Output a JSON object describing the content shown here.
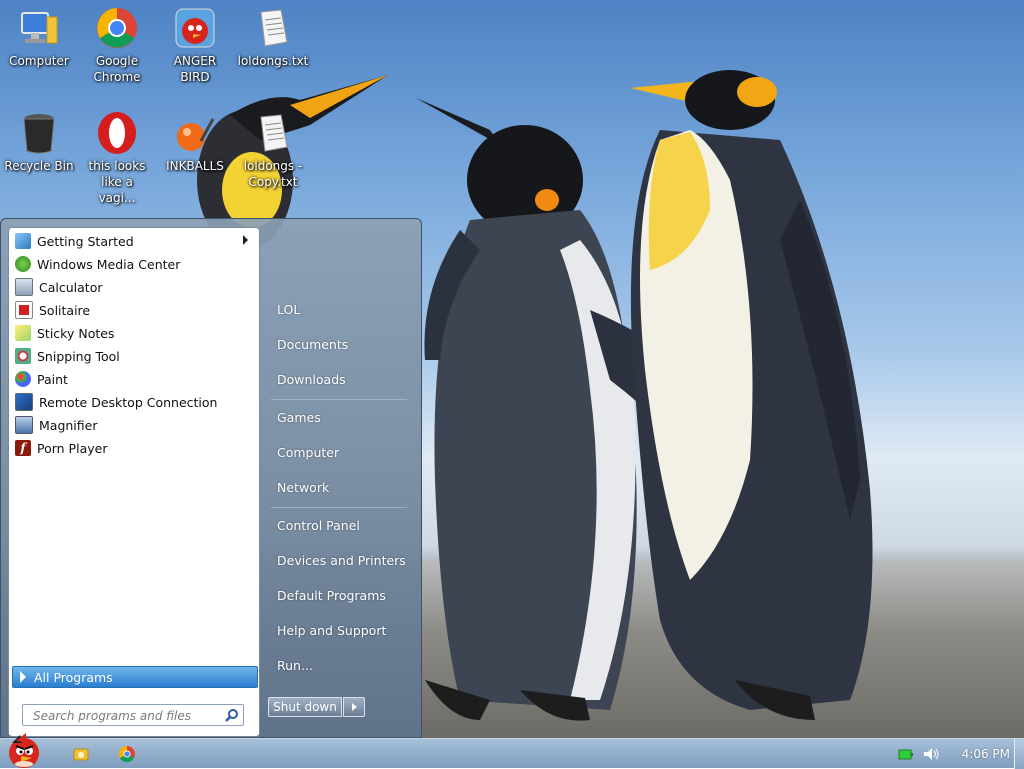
{
  "desktop": {
    "icons": [
      {
        "label": "Computer",
        "icon": "computer-icon"
      },
      {
        "label": "Google Chrome",
        "icon": "chrome-icon"
      },
      {
        "label": "ANGER BIRD",
        "icon": "angry-bird-icon"
      },
      {
        "label": "loldongs.txt",
        "icon": "text-file-icon"
      },
      {
        "label": "Recycle Bin",
        "icon": "recycle-bin-icon"
      },
      {
        "label": "this looks like a vagi...",
        "icon": "opera-icon"
      },
      {
        "label": "INKBALLS",
        "icon": "inkball-icon"
      },
      {
        "label": "loldongs - Copy.txt",
        "icon": "text-file-icon"
      }
    ]
  },
  "start_menu": {
    "programs": [
      {
        "label": "Getting Started",
        "icon": "getting-started-icon",
        "has_submenu": true
      },
      {
        "label": "Windows Media Center",
        "icon": "media-center-icon"
      },
      {
        "label": "Calculator",
        "icon": "calculator-icon"
      },
      {
        "label": "Solitaire",
        "icon": "solitaire-icon"
      },
      {
        "label": "Sticky Notes",
        "icon": "sticky-notes-icon"
      },
      {
        "label": "Snipping Tool",
        "icon": "snipping-tool-icon"
      },
      {
        "label": "Paint",
        "icon": "paint-icon"
      },
      {
        "label": "Remote Desktop Connection",
        "icon": "remote-desktop-icon"
      },
      {
        "label": "Magnifier",
        "icon": "magnifier-icon"
      },
      {
        "label": "Porn Player",
        "icon": "flash-player-icon"
      }
    ],
    "all_programs": "All Programs",
    "search_placeholder": "Search programs and files",
    "right_items": [
      {
        "label": "LOL"
      },
      {
        "label": "Documents"
      },
      {
        "label": "Downloads"
      },
      {
        "label": "Games"
      },
      {
        "label": "Computer"
      },
      {
        "label": "Network"
      },
      {
        "label": "Control Panel"
      },
      {
        "label": "Devices and Printers"
      },
      {
        "label": "Default Programs"
      },
      {
        "label": "Help and Support"
      },
      {
        "label": "Run..."
      }
    ],
    "shutdown_label": "Shut down"
  },
  "taskbar": {
    "pinned": [
      {
        "icon": "explorer-folder-icon"
      },
      {
        "icon": "chrome-icon"
      }
    ],
    "tray": {
      "icons": [
        "battery-icon",
        "speaker-icon"
      ],
      "clock": "4:06 PM"
    }
  },
  "colors": {
    "selection_blue": "#2a7dd0",
    "taskbar": "#8fa9c6",
    "startmenu_right": "#6f849c"
  }
}
